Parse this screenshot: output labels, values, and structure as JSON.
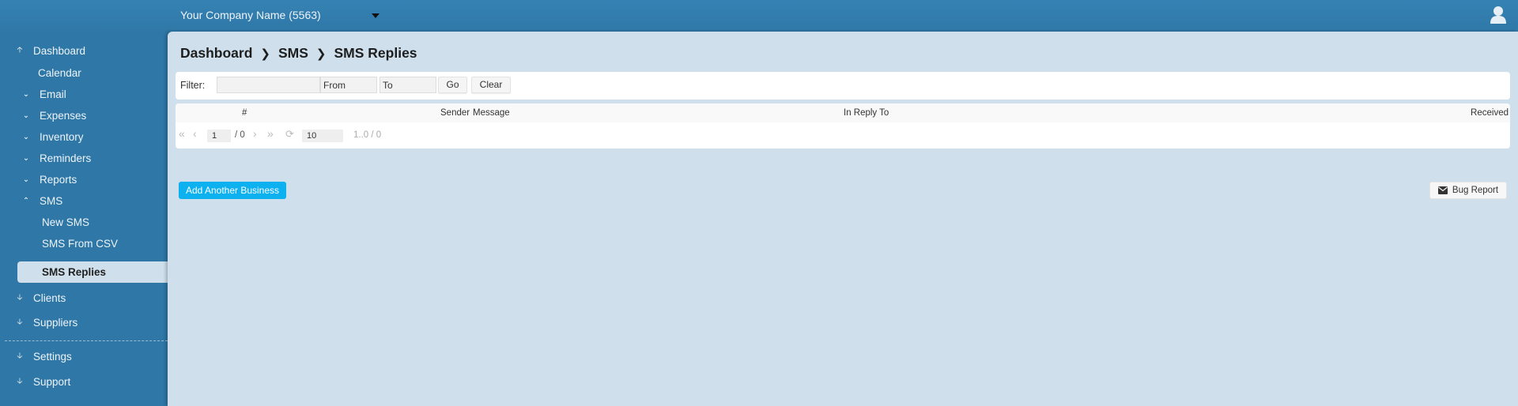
{
  "header": {
    "company": "Your Company Name (5563)",
    "caret_icon": "caret-down-icon",
    "user_icon": "user-icon"
  },
  "sidebar": {
    "items": [
      {
        "label": "Dashboard",
        "icon": "arrow-up-icon"
      },
      {
        "label": "Calendar",
        "icon": ""
      },
      {
        "label": "Email",
        "icon": "chevron-down-icon"
      },
      {
        "label": "Expenses",
        "icon": "chevron-down-icon"
      },
      {
        "label": "Inventory",
        "icon": "chevron-down-icon"
      },
      {
        "label": "Reminders",
        "icon": "chevron-down-icon"
      },
      {
        "label": "Reports",
        "icon": "chevron-down-icon"
      },
      {
        "label": "SMS",
        "icon": "chevron-up-icon"
      },
      {
        "label": "New SMS",
        "icon": ""
      },
      {
        "label": "SMS From CSV",
        "icon": ""
      },
      {
        "label": "SMS Replies",
        "icon": "",
        "active": true
      },
      {
        "label": "Clients",
        "icon": "arrow-down-icon"
      },
      {
        "label": "Suppliers",
        "icon": "arrow-down-icon"
      },
      {
        "label": "Settings",
        "icon": "arrow-down-icon"
      },
      {
        "label": "Support",
        "icon": "arrow-down-icon"
      }
    ]
  },
  "breadcrumb": [
    "Dashboard",
    "SMS",
    "SMS Replies"
  ],
  "filter": {
    "label": "Filter:",
    "text_value": "",
    "from_value": "From",
    "to_value": "To",
    "go_label": "Go",
    "clear_label": "Clear"
  },
  "table": {
    "columns": [
      "#",
      "Sender",
      "Message",
      "In Reply To",
      "Received"
    ],
    "rows": []
  },
  "pager": {
    "page": "1",
    "total_pages": "/ 0",
    "page_size": "10",
    "range": "1..0 / 0"
  },
  "actions": {
    "add_business": "Add Another Business",
    "bug_report": "Bug Report"
  },
  "colors": {
    "brand": "#2e77a6",
    "content_bg": "#cfe0ec",
    "accent_button": "#0eb1f0"
  }
}
